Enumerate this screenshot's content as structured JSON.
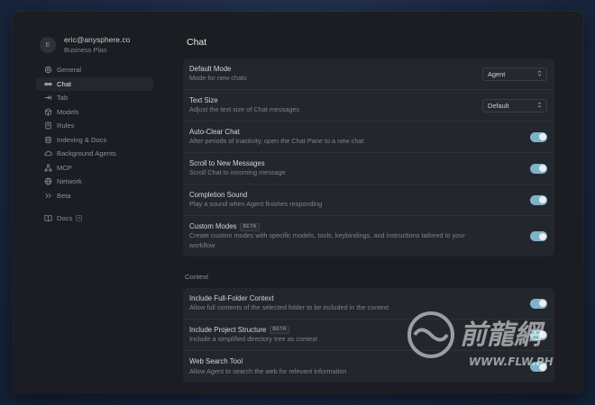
{
  "account": {
    "avatar_initial": "E",
    "email": "eric@anysphere.co",
    "plan": "Business Plan"
  },
  "sidebar": {
    "items": [
      {
        "label": "General",
        "icon": "gear-icon"
      },
      {
        "label": "Chat",
        "icon": "infinity-icon",
        "active": true
      },
      {
        "label": "Tab",
        "icon": "tab-arrow-icon"
      },
      {
        "label": "Models",
        "icon": "cube-icon"
      },
      {
        "label": "Rules",
        "icon": "book-icon"
      },
      {
        "label": "Indexing & Docs",
        "icon": "database-icon"
      },
      {
        "label": "Background Agents",
        "icon": "cloud-icon"
      },
      {
        "label": "MCP",
        "icon": "nodes-icon"
      },
      {
        "label": "Network",
        "icon": "globe-icon"
      },
      {
        "label": "Beta",
        "icon": "double-chevron-icon"
      }
    ],
    "docs": {
      "label": "Docs",
      "icon": "open-book-icon",
      "external_icon": "external-link-icon"
    }
  },
  "main": {
    "title": "Chat",
    "chat_settings": [
      {
        "title": "Default Mode",
        "desc": "Mode for new chats",
        "control": "select",
        "value": "Agent"
      },
      {
        "title": "Text Size",
        "desc": "Adjust the text size of Chat messages",
        "control": "select",
        "value": "Default"
      },
      {
        "title": "Auto-Clear Chat",
        "desc": "After periods of inactivity, open the Chat Pane to a new chat",
        "control": "toggle",
        "on": true
      },
      {
        "title": "Scroll to New Messages",
        "desc": "Scroll Chat to incoming message",
        "control": "toggle",
        "on": true
      },
      {
        "title": "Completion Sound",
        "desc": "Play a sound when Agent finishes responding",
        "control": "toggle",
        "on": true
      },
      {
        "title": "Custom Modes",
        "badge": "BETA",
        "desc": "Create custom modes with specific models, tools, keybindings, and instructions tailored to your",
        "desc2": "workflow",
        "control": "toggle",
        "on": true
      }
    ],
    "context_label": "Context",
    "context_settings": [
      {
        "title": "Include Full-Folder Context",
        "desc": "Allow full contents of the selected folder to be included in the context",
        "control": "toggle",
        "on": true
      },
      {
        "title": "Include Project Structure",
        "badge": "BETA",
        "desc": "Include a simplified directory tree as context",
        "control": "toggle",
        "on": true
      },
      {
        "title": "Web Search Tool",
        "desc": "Allow Agent to search the web for relevant information",
        "control": "toggle",
        "on": true
      }
    ]
  },
  "watermark": {
    "text_cn": "前龍網",
    "text_url": "WWW.FLW.PH"
  },
  "colors": {
    "toggle_on": "#7fb3c7",
    "window_bg": "#1b1d22",
    "card_bg": "#23262c"
  }
}
